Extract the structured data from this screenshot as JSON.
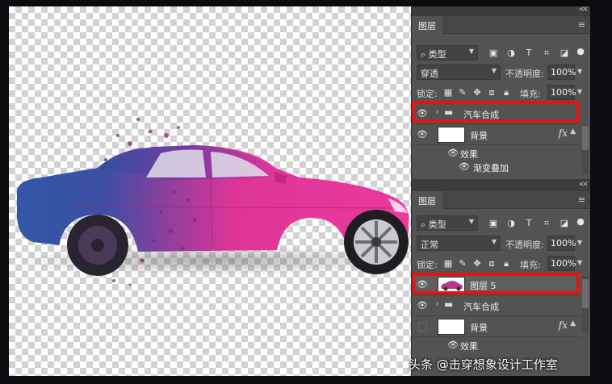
{
  "colors": {
    "highlight": "#e21414",
    "panel": "#535353",
    "car_pink": "#e0359b",
    "car_blue": "#2d4fa0"
  },
  "top_panel": {
    "tab": "图层",
    "kind_filter": "类型",
    "blend_mode": "穿透",
    "opacity_label": "不透明度:",
    "opacity_value": "100%",
    "lock_label": "锁定:",
    "fill_label": "填充:",
    "fill_value": "100%",
    "layers": [
      {
        "name": "汽车合成",
        "type": "group",
        "highlighted": true
      },
      {
        "name": "背景",
        "type": "layer",
        "has_fx": true,
        "fx_symbol": "fx"
      }
    ],
    "effects_label": "效果",
    "effect_item": "渐变叠加"
  },
  "bottom_panel": {
    "tab": "图层",
    "kind_filter": "类型",
    "blend_mode": "正常",
    "opacity_label": "不透明度:",
    "opacity_value": "100%",
    "lock_label": "锁定:",
    "fill_label": "填充:",
    "fill_value": "100%",
    "layers": [
      {
        "name": "图层 5",
        "type": "layer",
        "highlighted": true
      },
      {
        "name": "汽车合成",
        "type": "group"
      },
      {
        "name": "背景",
        "type": "layer",
        "has_fx": true,
        "fx_symbol": "fx"
      }
    ],
    "effects_label": "效果"
  },
  "icons": [
    "search-icon",
    "image-filter-icon",
    "circle-filter-icon",
    "text-filter-icon",
    "shape-filter-icon",
    "smart-object-filter-icon",
    "filter-toggle-icon",
    "lock-pixels-icon",
    "brush-lock-icon",
    "move-lock-icon",
    "artboard-lock-icon",
    "padlock-icon",
    "eye-icon",
    "folder-icon"
  ],
  "watermark": "头条 @击穿想象设计工作室"
}
